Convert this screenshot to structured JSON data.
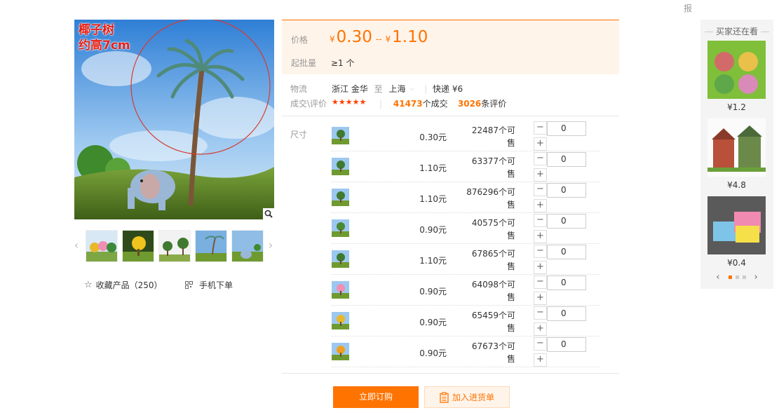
{
  "top": {
    "report_text": "报"
  },
  "gallery": {
    "caption_line1": "椰子树",
    "caption_line2": "约高7cm",
    "thumb_prev": "‹",
    "thumb_next": "›",
    "favorite_label": "收藏产品（250）",
    "mobile_order_label": "手机下单"
  },
  "price": {
    "label": "价格",
    "currency": "¥",
    "min": "0.30",
    "range_sep": "--",
    "max": "1.10",
    "moq_label": "起批量",
    "moq_value": "≥1 个"
  },
  "logistics": {
    "label": "物流",
    "from": "浙江 金华",
    "to_word": "至",
    "dest": "上海",
    "express": "快递 ¥6"
  },
  "deals": {
    "label": "成交\\评价",
    "stars": "★★★★★",
    "deals_count": "41473",
    "deals_suffix": "个成交",
    "reviews_count": "3026",
    "reviews_suffix": "条评价"
  },
  "sku": {
    "label": "尺寸",
    "rows": [
      {
        "price": "0.30元",
        "stock_line1": "22487个可",
        "stock_line2": "售",
        "qty": "0"
      },
      {
        "price": "1.10元",
        "stock_line1": "63377个可",
        "stock_line2": "售",
        "qty": "0"
      },
      {
        "price": "1.10元",
        "stock_line1": "876296个可",
        "stock_line2": "售",
        "qty": "0"
      },
      {
        "price": "0.90元",
        "stock_line1": "40575个可",
        "stock_line2": "售",
        "qty": "0"
      },
      {
        "price": "1.10元",
        "stock_line1": "67865个可",
        "stock_line2": "售",
        "qty": "0"
      },
      {
        "price": "0.90元",
        "stock_line1": "64098个可",
        "stock_line2": "售",
        "qty": "0"
      },
      {
        "price": "0.90元",
        "stock_line1": "65459个可",
        "stock_line2": "售",
        "qty": "0"
      },
      {
        "price": "0.90元",
        "stock_line1": "67673个可",
        "stock_line2": "售",
        "qty": "0"
      }
    ],
    "minus": "−",
    "plus": "+"
  },
  "actions": {
    "order_label": "立即订购",
    "cart_label": "加入进货单"
  },
  "recs": {
    "title": "买家还在看",
    "items": [
      {
        "price": "¥1.2"
      },
      {
        "price": "¥4.8"
      },
      {
        "price": "¥0.4"
      }
    ],
    "prev": "‹",
    "next": "›"
  },
  "colors": {
    "accent": "#ff7300",
    "price_bg": "#fff4ea",
    "stars": "#ff4000",
    "caption": "#e62117"
  }
}
